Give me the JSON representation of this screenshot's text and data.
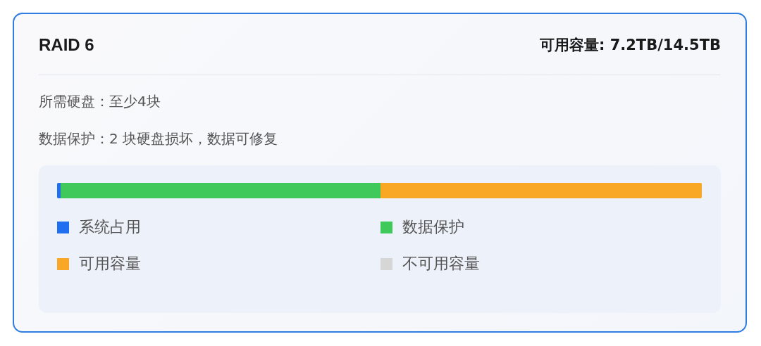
{
  "card": {
    "title": "RAID 6",
    "capacity": "可用容量: 7.2TB/14.5TB",
    "details": [
      "所需硬盘：至少4块",
      "数据保护：2 块硬盘损坏，数据可修复"
    ],
    "legend": [
      {
        "label": "系统占用",
        "color": "#1f6ff0",
        "level": 0.005
      },
      {
        "label": "数据保护",
        "color": "#3ec95a",
        "level": 0.497
      },
      {
        "label": "可用容量",
        "color": "#f9a825",
        "level": 0.498
      },
      {
        "label": "不可用容量",
        "color": "#d6d6d6",
        "level": 0
      }
    ]
  }
}
